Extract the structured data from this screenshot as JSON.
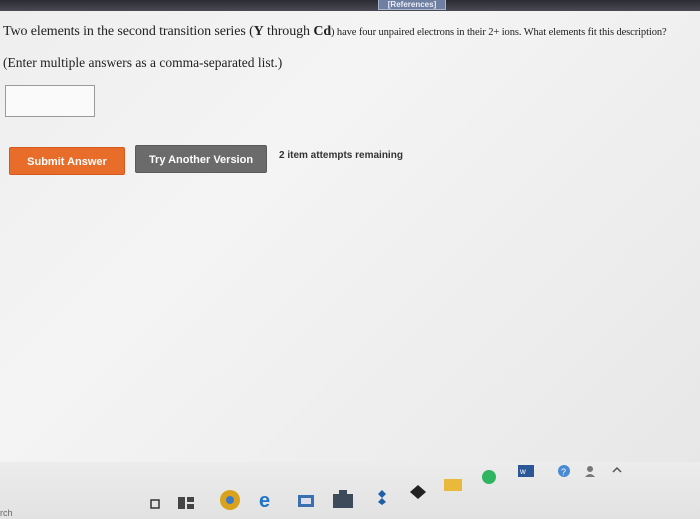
{
  "references_tab": "[References]",
  "question": {
    "part1": "Two elements in the second transition series (",
    "y_symbol": "Y",
    "part2": " through ",
    "cd_symbol": "Cd",
    "part3": ") have four unpaired electrons in their 2+ ions. What elements fit this description?"
  },
  "instruction": "(Enter multiple answers as a comma-separated list.)",
  "answer_input": {
    "value": ""
  },
  "buttons": {
    "submit": "Submit Answer",
    "try_another": "Try Another Version"
  },
  "attempts_text": "2 item attempts remaining",
  "taskbar": {
    "search_text": "rch",
    "icons": [
      "task-view-icon",
      "chrome-icon",
      "edge-icon",
      "file-explorer-icon",
      "store-icon",
      "dropbox-icon",
      "mail-icon",
      "sticky-notes-icon",
      "spotify-icon",
      "word-icon",
      "help-icon",
      "people-icon",
      "up-arrow-icon"
    ]
  }
}
